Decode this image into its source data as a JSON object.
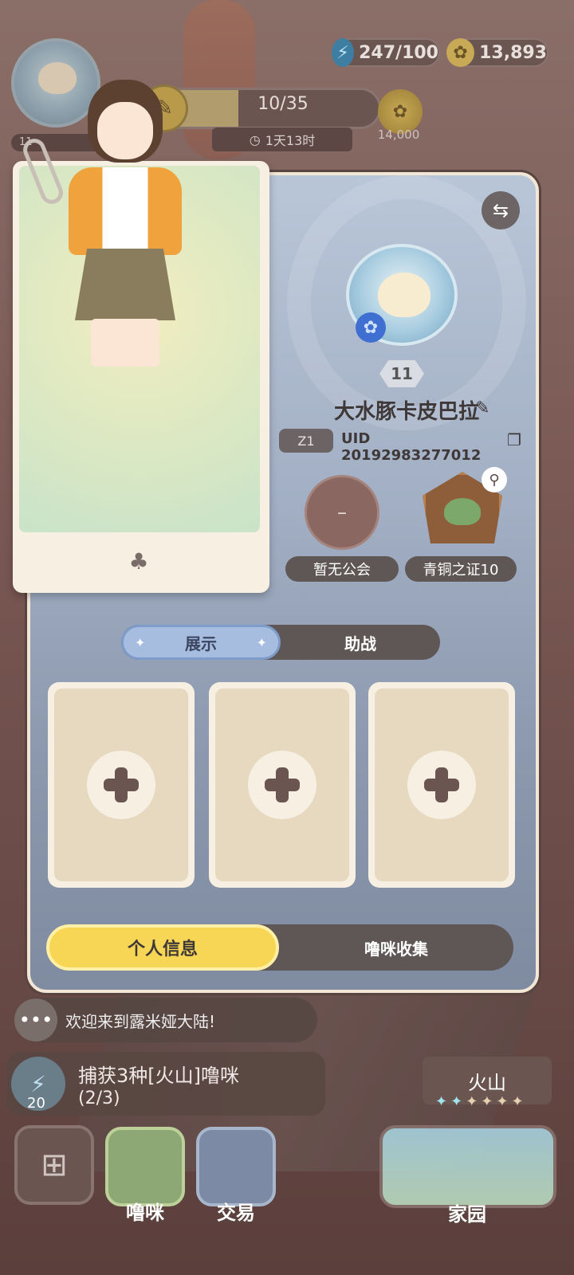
{
  "hud": {
    "energy": "247/100",
    "coins": "13,893",
    "task_progress_label": "10/35",
    "task_progress_fraction": 0.4,
    "task_timer": "1天13时",
    "task_reward": "14,000",
    "mini_level": "11"
  },
  "profile": {
    "level": "11",
    "nickname": "大水豚卡皮巴拉",
    "zone": "Z1",
    "uid": "UID 20192983277012",
    "guild_symbol": "–",
    "guild_label": "暂无公会",
    "badge_label": "青铜之证10"
  },
  "tabs": {
    "display": "展示",
    "assist": "助战",
    "active": "display"
  },
  "slots": [
    {
      "icon": "plus-icon"
    },
    {
      "icon": "plus-icon"
    },
    {
      "icon": "plus-icon"
    }
  ],
  "bottom_tabs": {
    "personal_info": "个人信息",
    "pet_collection": "噜咪收集",
    "active": "personal_info"
  },
  "chat": {
    "message": "欢迎来到露米娅大陆!"
  },
  "quest": {
    "energy_cost": "20",
    "title": "捕获3种[火山]噜咪",
    "progress": "(2/3)"
  },
  "area": {
    "name": "火山",
    "stars_filled": 2,
    "stars_total": 6
  },
  "dock": {
    "pet_label": "噜咪",
    "trade_label": "交易",
    "home_label": "家园"
  },
  "colors": {
    "accent_yellow": "#f8d655",
    "tab_blue": "#a7bde0",
    "panel_top": "#b9c6d8",
    "dark_pill": "#5f5656"
  }
}
